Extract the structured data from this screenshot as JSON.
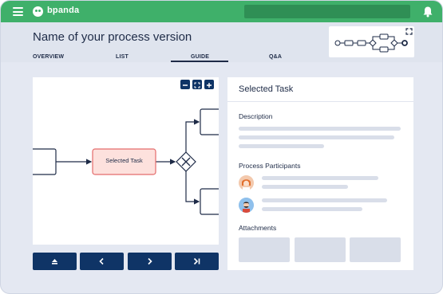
{
  "app": {
    "brand_name": "bpanda",
    "hamburger_icon": "hamburger-menu-icon",
    "logo_icon": "panda-logo-icon",
    "bell_icon": "bell-icon",
    "colors": {
      "topbar": "#3fb06a",
      "primary": "#0f3466",
      "task_fill": "#fde1dd",
      "task_stroke": "#e46c6c"
    }
  },
  "header": {
    "title": "Name of your process version",
    "tabs": [
      {
        "label": "OVERVIEW"
      },
      {
        "label": "LIST"
      },
      {
        "label": "GUIDE",
        "active": true
      },
      {
        "label": "Q&A"
      }
    ]
  },
  "diagram": {
    "selected_task_label": "Selected Task",
    "zoom_controls": [
      "zoom-out-icon",
      "fit-screen-icon",
      "zoom-in-icon"
    ],
    "navigation": [
      {
        "name": "eject-icon",
        "glyph": "⏏"
      },
      {
        "name": "previous-icon",
        "glyph": "‹"
      },
      {
        "name": "next-icon",
        "glyph": "›"
      },
      {
        "name": "last-icon",
        "glyph": "›|"
      }
    ]
  },
  "task_panel": {
    "title": "Selected Task",
    "description_label": "Description",
    "participants_label": "Process Participants",
    "attachments_label": "Attachments"
  }
}
